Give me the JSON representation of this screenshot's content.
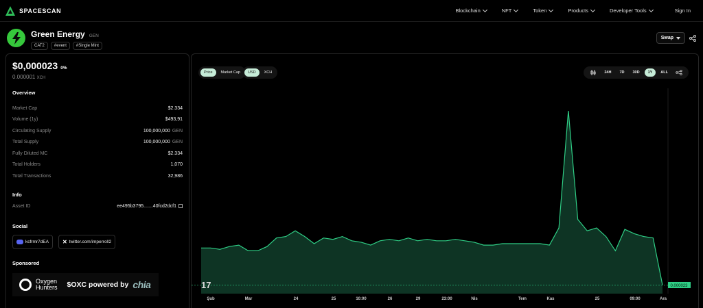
{
  "nav": {
    "brand": "SPACESCAN",
    "items": [
      {
        "label": "Blockchain"
      },
      {
        "label": "NFT"
      },
      {
        "label": "Token"
      },
      {
        "label": "Products"
      },
      {
        "label": "Developer Tools"
      }
    ],
    "signin": "Sign In"
  },
  "token": {
    "name": "Green Energy",
    "symbol": "GEN",
    "tags": [
      "CAT2",
      "#event",
      "#Single Mint"
    ],
    "swap_label": "Swap"
  },
  "price": {
    "usd": "$0,000023",
    "change": "0%",
    "xch_value": "0.000001",
    "xch_unit": "XCH"
  },
  "overview": {
    "title": "Overview",
    "rows": [
      {
        "label": "Market Cap",
        "value": "$2.334",
        "unit": ""
      },
      {
        "label": "Volume (1y)",
        "value": "$493,91",
        "unit": ""
      },
      {
        "label": "Circulating Supply",
        "value": "100,000,000",
        "unit": "GEN"
      },
      {
        "label": "Total Supply",
        "value": "100,000,000",
        "unit": "GEN"
      },
      {
        "label": "Fully Diluted MC",
        "value": "$2.334",
        "unit": ""
      },
      {
        "label": "Total Holders",
        "value": "1,070",
        "unit": ""
      },
      {
        "label": "Total Transactions",
        "value": "32,986",
        "unit": ""
      }
    ]
  },
  "info": {
    "title": "Info",
    "asset_label": "Asset ID",
    "asset_value": "ee495b3795.......40fcd2dcf1"
  },
  "social": {
    "title": "Social",
    "discord": "kcfrmr7dEA",
    "twitter": "twitter.com/imperroll2"
  },
  "sponsored": {
    "title": "Sponsored",
    "brand_line1": "Oxygen",
    "brand_line2": "Hunters",
    "text": "$OXC powered by",
    "partner": "chia"
  },
  "chart_controls": {
    "metric": [
      "Price",
      "Market Cap"
    ],
    "currency": [
      "USD",
      "XCH"
    ],
    "ranges": [
      "24H",
      "7D",
      "30D",
      "1Y",
      "ALL"
    ],
    "active_range": "1Y"
  },
  "chart_data": {
    "type": "area",
    "x_labels": [
      "Şub",
      "Mar",
      "24",
      "25",
      "10:00",
      "26",
      "29",
      "23:00",
      "Nis",
      "Tem",
      "Kas",
      "25",
      "09:00",
      "Ara"
    ],
    "y": [
      3.6e-05,
      3.6e-05,
      3.55e-05,
      3.65e-05,
      3.7e-05,
      3.5e-05,
      3.5e-05,
      3.65e-05,
      3.95e-05,
      4e-05,
      4.2e-05,
      4e-05,
      3.75e-05,
      3.95e-05,
      3.9e-05,
      4e-05,
      3.85e-05,
      3.8e-05,
      3.7e-05,
      3.85e-05,
      3.9e-05,
      3.85e-05,
      3.95e-05,
      3.85e-05,
      3.9e-05,
      3.85e-05,
      3.85e-05,
      3.9e-05,
      3.85e-05,
      3.8e-05,
      3.7e-05,
      3.7e-05,
      3.75e-05,
      3.75e-05,
      3.75e-05,
      3.75e-05,
      3.75e-05,
      3.7e-05,
      4.3e-05,
      8.4e-05,
      4.6e-05,
      4.2e-05,
      4.3e-05,
      4e-05,
      3.5e-05,
      4.25e-05,
      4.1e-05,
      4e-05,
      3.95e-05,
      2.3e-05
    ],
    "last_value_label": "0,000023",
    "y_range": [
      2e-05,
      9e-05
    ],
    "line_color": "#2fcf86",
    "fill_color": "#0f3a28",
    "watermark": "17"
  }
}
